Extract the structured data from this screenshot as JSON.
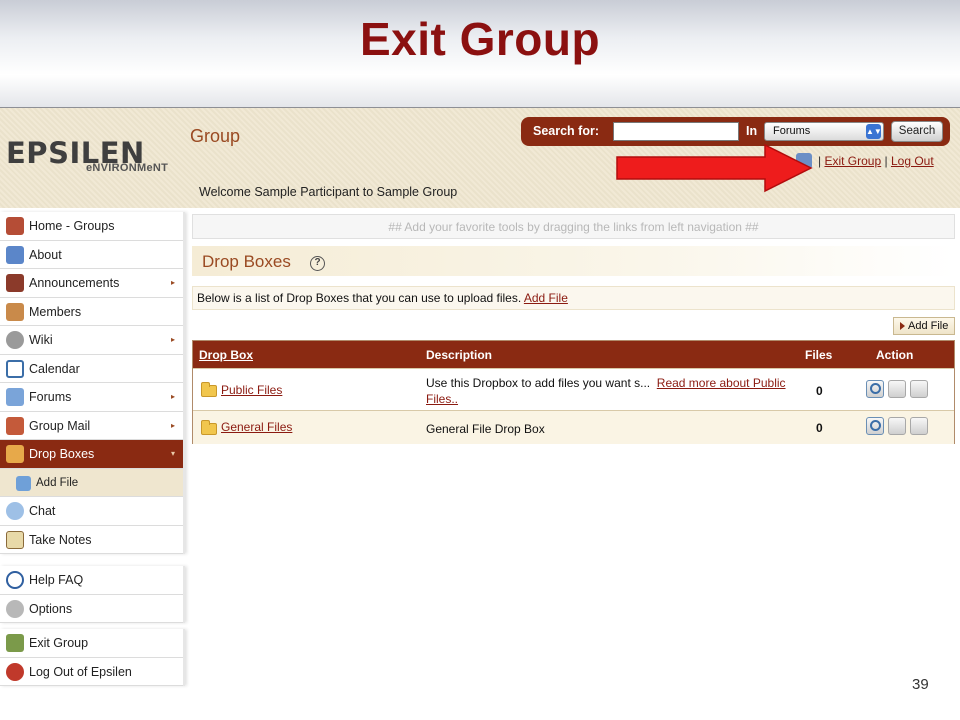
{
  "slide": {
    "title": "Exit Group",
    "page_number": "39"
  },
  "header": {
    "logo_main_prefix": "",
    "logo_main": "EPSILEN",
    "logo_sub": "eNVIRONMeNT",
    "group_title": "Group",
    "welcome": "Welcome Sample Participant to Sample Group",
    "search_label": "Search for:",
    "search_value": "",
    "in_label": "In",
    "search_scope": "Forums",
    "search_button": "Search",
    "separator1": "|",
    "exit_group_link": "Exit Group",
    "separator2": "|",
    "logout_link": "Log Out"
  },
  "sidebar": {
    "items": [
      {
        "label": "Home - Groups",
        "icon": "home-icon"
      },
      {
        "label": "About",
        "icon": "people-icon"
      },
      {
        "label": "Announcements",
        "icon": "announcement-icon",
        "chevron": "▸"
      },
      {
        "label": "Members",
        "icon": "members-icon"
      },
      {
        "label": "Wiki",
        "icon": "wiki-icon",
        "chevron": "▸"
      },
      {
        "label": "Calendar",
        "icon": "calendar-icon"
      },
      {
        "label": "Forums",
        "icon": "forums-icon",
        "chevron": "▸"
      },
      {
        "label": "Group Mail",
        "icon": "mail-icon",
        "chevron": "▸"
      },
      {
        "label": "Drop Boxes",
        "icon": "dropbox-icon",
        "chevron": "▾",
        "active": true
      },
      {
        "label": "Add File",
        "icon": "add-file-icon",
        "sub": true
      },
      {
        "label": "Chat",
        "icon": "chat-icon"
      },
      {
        "label": "Take Notes",
        "icon": "notes-icon"
      }
    ],
    "help_items": [
      {
        "label": "Help FAQ",
        "icon": "help-icon"
      },
      {
        "label": "Options",
        "icon": "options-icon"
      }
    ],
    "exit_items": [
      {
        "label": "Exit Group",
        "icon": "exit-icon"
      },
      {
        "label": "Log Out of Epsilen",
        "icon": "logout-icon"
      }
    ]
  },
  "main": {
    "tools_hint": "## Add your favorite tools by dragging the links from left navigation ##",
    "section_title": "Drop Boxes",
    "help_glyph": "?",
    "intro_text": "Below is a list of Drop Boxes that you can use to upload files.",
    "intro_link": "Add File",
    "add_file_button": "Add File",
    "table": {
      "headers": [
        "Drop Box",
        "Description",
        "Files",
        "Action"
      ],
      "rows": [
        {
          "name": "Public Files",
          "description": "Use this Dropbox to add files you want s...",
          "description_link": "Read more about Public Files..",
          "files": "0"
        },
        {
          "name": "General Files",
          "description": "General File Drop Box",
          "description_link": "",
          "files": "0"
        }
      ]
    }
  },
  "colors": {
    "brand_dark_red": "#8a2a12",
    "title_red": "#8b1010",
    "link_red": "#8b1a10",
    "beige": "#efe6cf",
    "arrow_red": "#ee1c1c"
  }
}
